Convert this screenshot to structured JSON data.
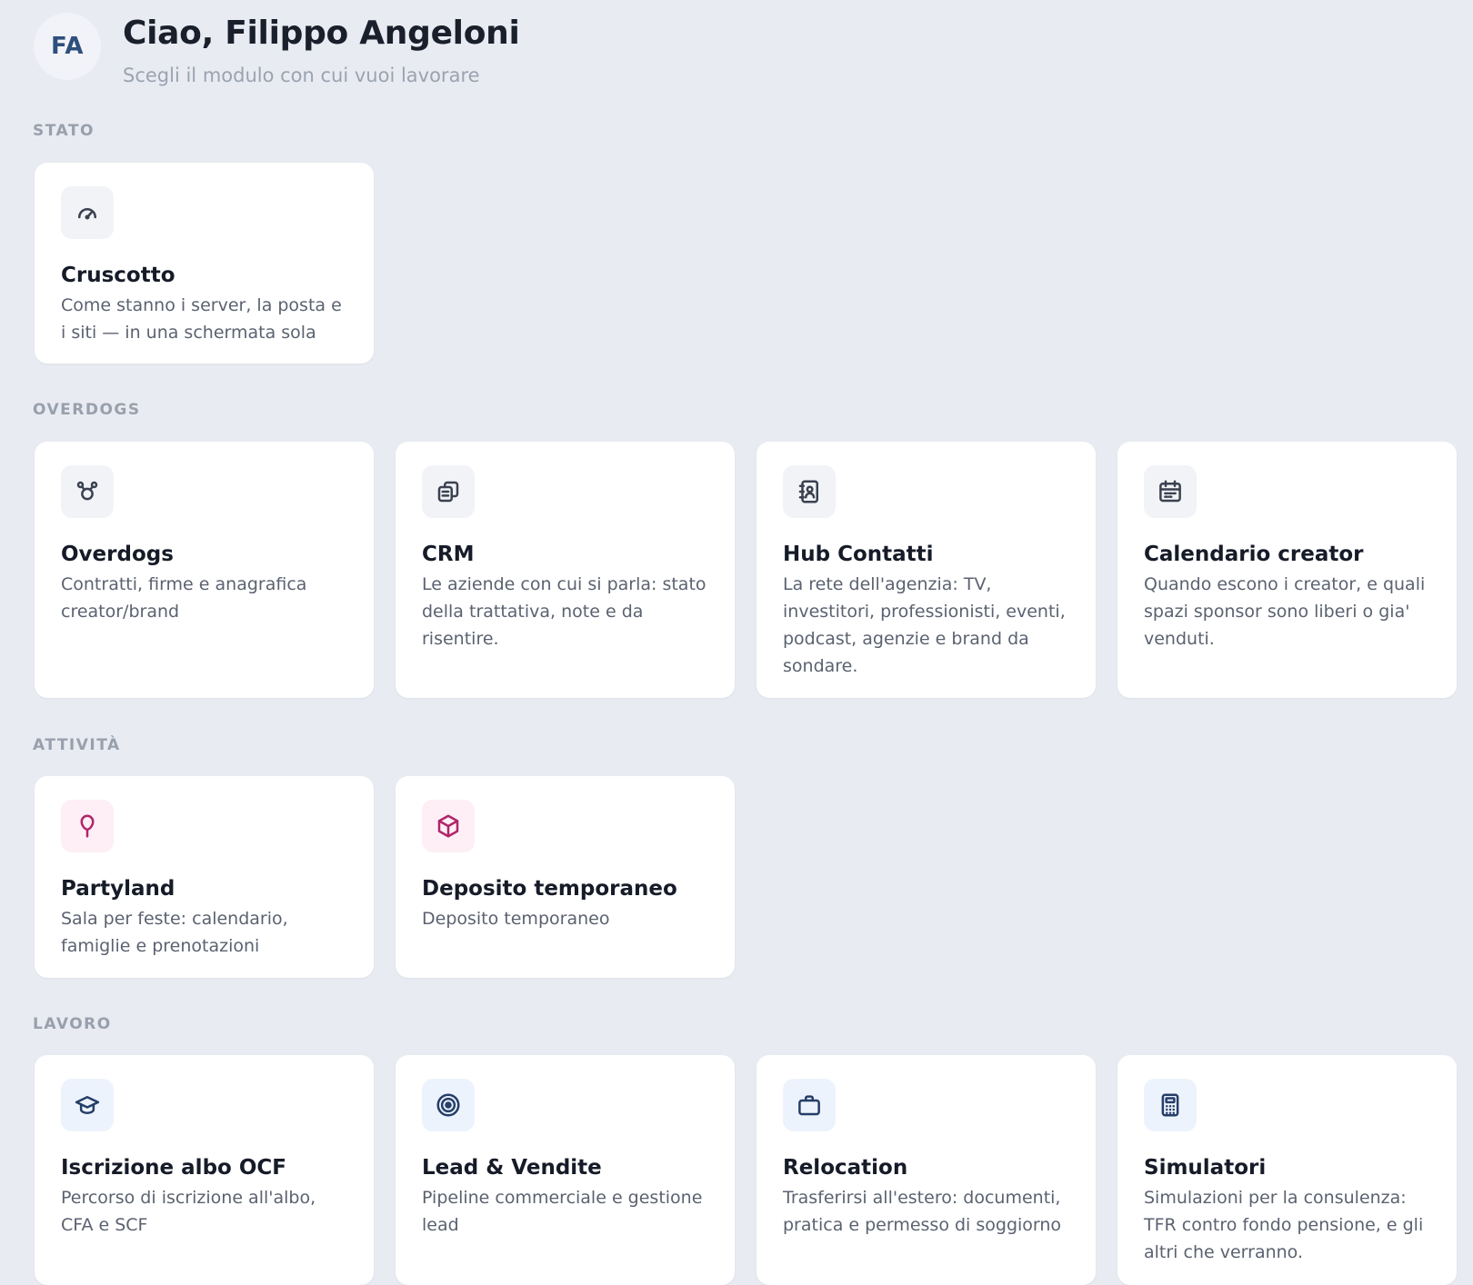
{
  "user": {
    "initials": "FA",
    "greeting": "Ciao, Filippo Angeloni",
    "subtitle": "Scegli il modulo con cui vuoi lavorare"
  },
  "sections": {
    "stato": {
      "label": "STATO",
      "cards": [
        {
          "title": "Cruscotto",
          "description": "Come stanno i server, la posta e i siti — in una schermata sola",
          "icon": "gauge-icon"
        }
      ]
    },
    "overdogs": {
      "label": "OVERDOGS",
      "cards": [
        {
          "title": "Overdogs",
          "description": "Contratti, firme e anagrafica creator/brand",
          "icon": "network-icon"
        },
        {
          "title": "CRM",
          "description": "Le aziende con cui si parla: stato della trattativa, note e da risentire.",
          "icon": "documents-icon"
        },
        {
          "title": "Hub Contatti",
          "description": "La rete dell'agenzia: TV, investitori, professionisti, eventi, podcast, agenzie e brand da sondare.",
          "icon": "address-book-icon"
        },
        {
          "title": "Calendario creator",
          "description": "Quando escono i creator, e quali spazi sponsor sono liberi o gia' venduti.",
          "icon": "calendar-icon"
        }
      ]
    },
    "attivita": {
      "label": "ATTIVITÀ",
      "cards": [
        {
          "title": "Partyland",
          "description": "Sala per feste: calendario, famiglie e prenotazioni",
          "icon": "balloon-icon"
        },
        {
          "title": "Deposito temporaneo",
          "description": "Deposito temporaneo",
          "icon": "box-icon"
        }
      ]
    },
    "lavoro": {
      "label": "LAVORO",
      "cards": [
        {
          "title": "Iscrizione albo OCF",
          "description": "Percorso di iscrizione all'albo, CFA e SCF",
          "icon": "graduation-cap-icon"
        },
        {
          "title": "Lead & Vendite",
          "description": "Pipeline commerciale e gestione lead",
          "icon": "target-icon"
        },
        {
          "title": "Relocation",
          "description": "Trasferirsi all'estero: documenti, pratica e permesso di soggiorno",
          "icon": "briefcase-icon"
        },
        {
          "title": "Simulatori",
          "description": "Simulazioni per la consulenza: TFR contro fondo pensione, e gli altri che verranno.",
          "icon": "calculator-icon"
        }
      ]
    }
  },
  "colors": {
    "background": "#e8ebf1",
    "card": "#ffffff",
    "accent_pink": "#b0256a",
    "accent_navy": "#253e68"
  }
}
